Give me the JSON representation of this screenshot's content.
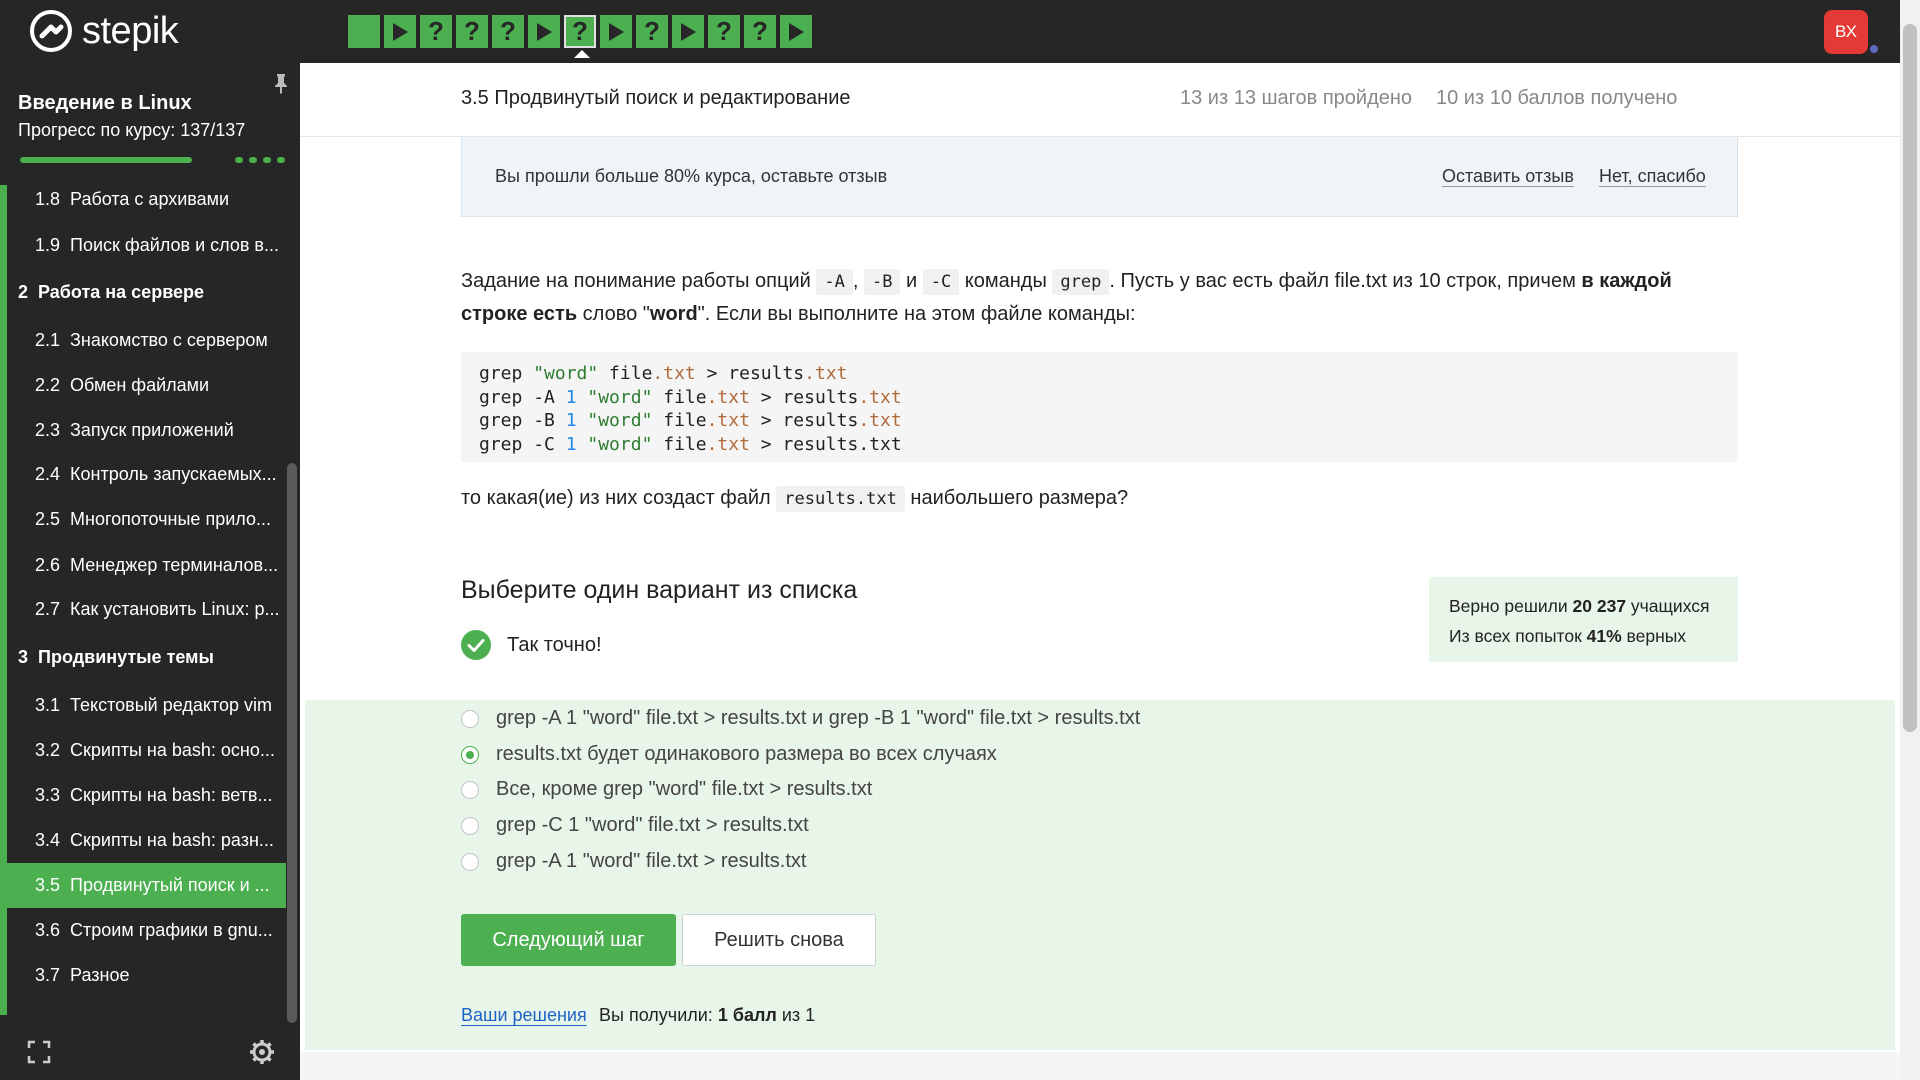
{
  "topbar": {
    "brand": "stepik",
    "steps": [
      {
        "kind": "text"
      },
      {
        "kind": "video"
      },
      {
        "kind": "quiz"
      },
      {
        "kind": "quiz"
      },
      {
        "kind": "quiz"
      },
      {
        "kind": "video"
      },
      {
        "kind": "quiz",
        "current": true
      },
      {
        "kind": "video"
      },
      {
        "kind": "quiz"
      },
      {
        "kind": "video"
      },
      {
        "kind": "quiz"
      },
      {
        "kind": "quiz"
      },
      {
        "kind": "video"
      }
    ],
    "quiz_glyph": "?",
    "avatar_initials": "ВХ",
    "colors": {
      "bg": "#262626",
      "accent": "#4caf50",
      "avatar": "#e53935",
      "notify_dot": "#5c6bc0"
    }
  },
  "sidebar": {
    "course_title": "Введение в Linux",
    "progress_label": "Прогресс по курсу:",
    "progress_value": "137/137",
    "progress_fraction": 1.0,
    "items": [
      {
        "type": "lesson",
        "num": "1.8",
        "label": "Работа с архивами"
      },
      {
        "type": "lesson",
        "num": "1.9",
        "label": "Поиск файлов и слов в..."
      },
      {
        "type": "module",
        "num": "2",
        "label": "Работа на сервере"
      },
      {
        "type": "lesson",
        "num": "2.1",
        "label": "Знакомство с сервером"
      },
      {
        "type": "lesson",
        "num": "2.2",
        "label": "Обмен файлами"
      },
      {
        "type": "lesson",
        "num": "2.3",
        "label": "Запуск приложений"
      },
      {
        "type": "lesson",
        "num": "2.4",
        "label": "Контроль запускаемых..."
      },
      {
        "type": "lesson",
        "num": "2.5",
        "label": "Многопоточные прило..."
      },
      {
        "type": "lesson",
        "num": "2.6",
        "label": "Менеджер терминалов..."
      },
      {
        "type": "lesson",
        "num": "2.7",
        "label": "Как установить Linux: р..."
      },
      {
        "type": "module",
        "num": "3",
        "label": "Продвинутые темы"
      },
      {
        "type": "lesson",
        "num": "3.1",
        "label": "Текстовый редактор vim"
      },
      {
        "type": "lesson",
        "num": "3.2",
        "label": "Скрипты на bash: осно..."
      },
      {
        "type": "lesson",
        "num": "3.3",
        "label": "Скрипты на bash: ветв..."
      },
      {
        "type": "lesson",
        "num": "3.4",
        "label": "Скрипты на bash: разн..."
      },
      {
        "type": "lesson",
        "num": "3.5",
        "label": "Продвинутый поиск и ...",
        "active": true
      },
      {
        "type": "lesson",
        "num": "3.6",
        "label": "Строим графики в gnu..."
      },
      {
        "type": "lesson",
        "num": "3.7",
        "label": "Разное"
      }
    ]
  },
  "header": {
    "lesson_title": "3.5 Продвинутый поиск и редактирование",
    "steps_done": "13 из 13 шагов пройдено",
    "score_done": "10 из 10 баллов  получено"
  },
  "banner": {
    "text": "Вы прошли больше 80% курса, оставьте отзыв",
    "leave_review": "Оставить отзыв",
    "no_thanks": "Нет, спасибо"
  },
  "task": {
    "p1_a": "Задание на понимание работы опций ",
    "opt_a": "-A",
    "comma": ",",
    "opt_b": "-B",
    "and": " и ",
    "opt_c": "-C",
    "p1_b": " команды ",
    "grep": "grep",
    "p1_c": ". Пусть у вас есть файл file.txt из 10 строк, причем ",
    "bold1": "в каждой строке есть",
    "p1_d": " слово \"",
    "bold2": "word",
    "p1_e": "\". Если вы выполните на этом файле команды:",
    "p2_a": "то какая(ие) из них создаст файл ",
    "results_file": "results.txt",
    "p2_b": " наибольшего размера?"
  },
  "code_lines": [
    {
      "cmd": "grep ",
      "flag": "",
      "num": "",
      "str": "\"word\"",
      "f1": " file",
      "e1": ".txt",
      "mid": " > results",
      "e2": ".txt"
    },
    {
      "cmd": "grep ",
      "flag": "-A ",
      "num": "1",
      "str": " \"word\"",
      "f1": " file",
      "e1": ".txt",
      "mid": " > results",
      "e2": ".txt"
    },
    {
      "cmd": "grep ",
      "flag": "-B ",
      "num": "1",
      "str": " \"word\"",
      "f1": " file",
      "e1": ".txt",
      "mid": " > results",
      "e2": ".txt"
    },
    {
      "cmd": "grep ",
      "flag": "-C ",
      "num": "1",
      "str": " \"word\"",
      "f1": " file",
      "e1": ".txt",
      "mid": " > results.txt",
      "e2": ""
    }
  ],
  "quiz": {
    "choose_title": "Выберите один вариант из списка",
    "correct_text": "Так точно!",
    "stats_line1_a": "Верно решили ",
    "stats_line1_b": "20 237",
    "stats_line1_c": " учащихся",
    "stats_line2_a": "Из всех попыток ",
    "stats_line2_b": "41%",
    "stats_line2_c": " верных",
    "options": [
      {
        "label": "grep -A 1 \"word\" file.txt > results.txt и grep -B 1 \"word\" file.txt > results.txt",
        "checked": false
      },
      {
        "label": "results.txt будет одинакового размера во всех случаях",
        "checked": true
      },
      {
        "label": "Все, кроме grep \"word\" file.txt > results.txt",
        "checked": false
      },
      {
        "label": "grep -C 1 \"word\" file.txt > results.txt",
        "checked": false
      },
      {
        "label": "grep -A 1 \"word\" file.txt > results.txt",
        "checked": false
      }
    ],
    "next_button": "Следующий шаг",
    "again_button": "Решить снова",
    "your_solutions": "Ваши решения",
    "got_a": "Вы получили: ",
    "got_b": "1 балл",
    "got_c": " из 1"
  }
}
